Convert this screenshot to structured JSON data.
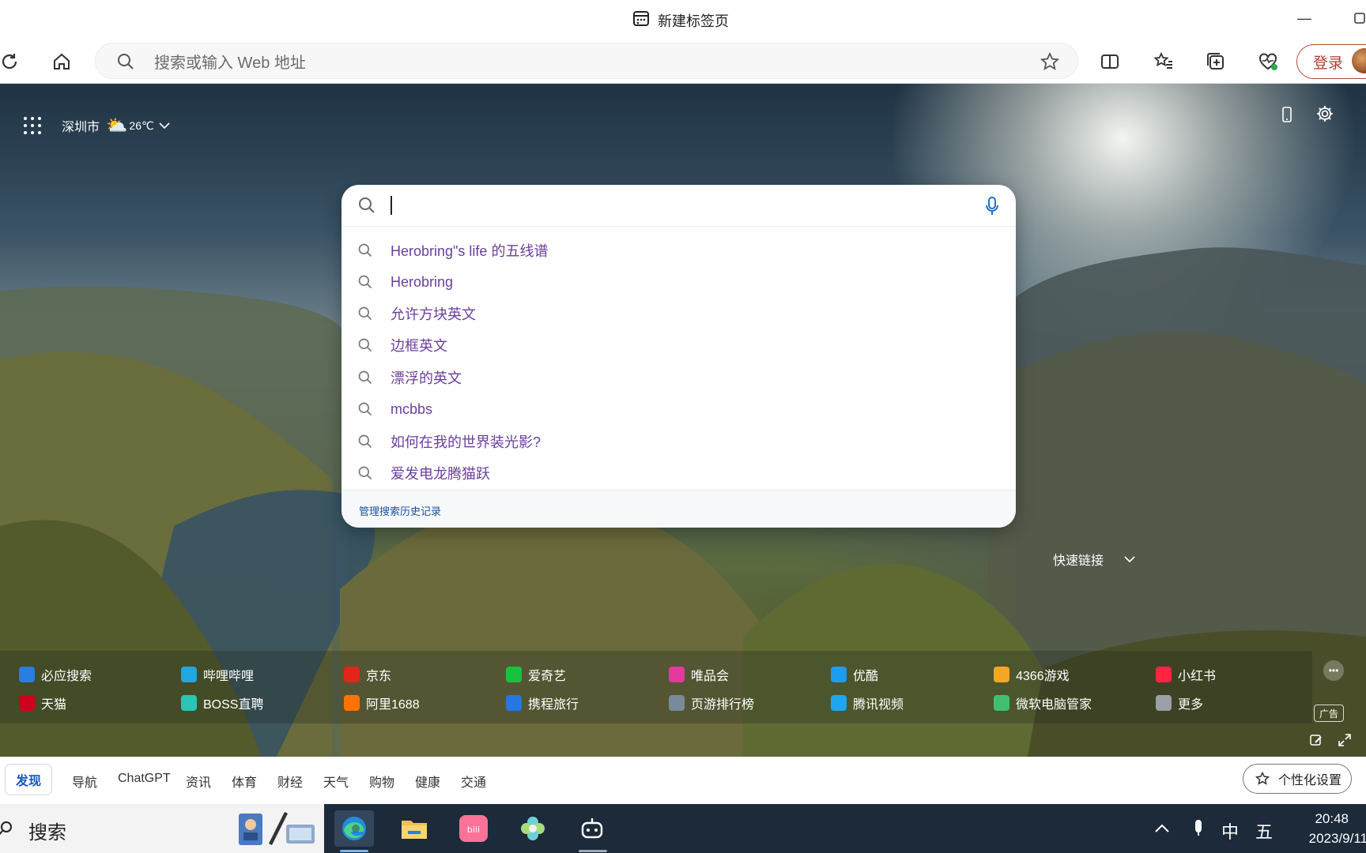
{
  "titlebar": {
    "tab_title": "新建标签页"
  },
  "toolbar": {
    "address_placeholder": "搜索或输入 Web 地址",
    "login_label": "登录"
  },
  "weather": {
    "city": "深圳市",
    "temp": "26℃"
  },
  "search": {
    "suggestions": [
      "Herobring\"s life 的五线谱",
      "Herobring",
      "允许方块英文",
      "边框英文",
      "漂浮的英文",
      "mcbbs",
      "如何在我的世界装光影?",
      "爱发电龙腾猫跃"
    ],
    "manage_history": "管理搜索历史记录"
  },
  "quick_links": {
    "label": "快速链接",
    "row1": [
      {
        "label": "必应搜索",
        "icon": "bing-icon",
        "color": "#2a7de1"
      },
      {
        "label": "哔哩哔哩",
        "icon": "bilibili-icon",
        "color": "#21a6e0"
      },
      {
        "label": "京东",
        "icon": "jd-icon",
        "color": "#e1251b"
      },
      {
        "label": "爱奇艺",
        "icon": "iqiyi-icon",
        "color": "#19c140"
      },
      {
        "label": "唯品会",
        "icon": "vip-icon",
        "color": "#e4399e"
      },
      {
        "label": "优酷",
        "icon": "youku-icon",
        "color": "#1e9cf0"
      },
      {
        "label": "4366游戏",
        "icon": "game-4366-icon",
        "color": "#f5a623"
      },
      {
        "label": "小红书",
        "icon": "xiaohongshu-icon",
        "color": "#ff2442"
      }
    ],
    "row2": [
      {
        "label": "天猫",
        "icon": "tmall-icon",
        "color": "#d0021b"
      },
      {
        "label": "BOSS直聘",
        "icon": "boss-icon",
        "color": "#29c5b5"
      },
      {
        "label": "阿里1688",
        "icon": "ali1688-icon",
        "color": "#ff7300"
      },
      {
        "label": "携程旅行",
        "icon": "ctrip-icon",
        "color": "#2577e3"
      },
      {
        "label": "页游排行榜",
        "icon": "binoculars-icon",
        "color": "#7a8a9a"
      },
      {
        "label": "腾讯视频",
        "icon": "tencent-video-icon",
        "color": "#1fa6f2"
      },
      {
        "label": "微软电脑管家",
        "icon": "pc-manager-icon",
        "color": "#3fbf6f"
      },
      {
        "label": "更多",
        "icon": "more-apps-icon",
        "color": "#9aa0a6"
      }
    ],
    "ad_label": "广告"
  },
  "feed_tabs": [
    "发现",
    "导航",
    "ChatGPT",
    "资讯",
    "体育",
    "财经",
    "天气",
    "购物",
    "健康",
    "交通"
  ],
  "personalize_label": "个性化设置",
  "taskbar": {
    "search_label": "搜索",
    "ime_label": "中",
    "ime_mode": "五",
    "time": "20:48",
    "date": "2023/9/11"
  }
}
